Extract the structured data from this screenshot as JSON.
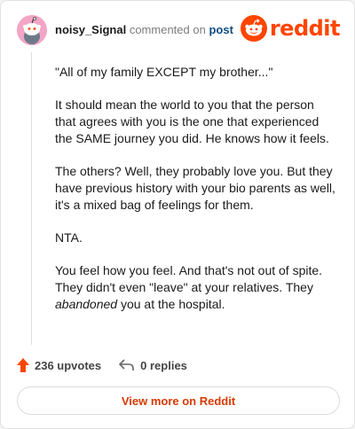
{
  "header": {
    "username": "noisy_Signal",
    "action_text": "commented on",
    "post_link": "post",
    "logo_text": "reddit"
  },
  "comment": {
    "paragraphs": [
      "\"All of my family EXCEPT my brother...\"",
      "It should mean the world to you that the person that agrees with you is the one that experienced the SAME journey you did. He knows how it feels.",
      "The others? Well, they probably love you. But they have previous history with your bio parents as well, it's a mixed bag of feelings for them.",
      "NTA.",
      "You feel how you feel. And that's not out of spite. They didn't even \"leave\" at your relatives. They"
    ],
    "last_emphasis": "abandoned",
    "last_tail": " you at the hospital."
  },
  "footer": {
    "upvotes": "236 upvotes",
    "replies": "0 replies",
    "view_more": "View more on Reddit"
  },
  "colors": {
    "brand": "#ff4500",
    "link": "#0f4c81",
    "button_text": "#d93900"
  },
  "icons": {
    "avatar": "snoo-avatar-icon",
    "upvote": "upvote-arrow-icon",
    "reply": "reply-arrow-icon",
    "logo": "reddit-snoo-icon"
  }
}
